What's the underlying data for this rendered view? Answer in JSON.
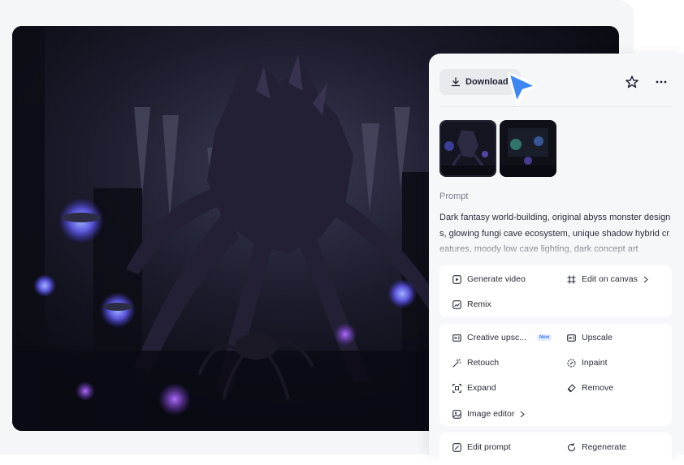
{
  "panel": {
    "download_label": "Download",
    "prompt_label": "Prompt",
    "prompt_text": "Dark fantasy world-building, original abyss monster designs, glowing fungi cave ecosystem, unique shadow hybrid creatures, moody low cave lighting, dark concept art"
  },
  "actions_primary": {
    "generate_video": "Generate video",
    "edit_on_canvas": "Edit on canvas",
    "remix": "Remix"
  },
  "actions_edit": {
    "creative_upscale": "Creative upsc...",
    "creative_upscale_badge": "New",
    "upscale": "Upscale",
    "retouch": "Retouch",
    "inpaint": "Inpaint",
    "expand": "Expand",
    "remove": "Remove",
    "image_editor": "Image editor"
  },
  "actions_bottom": {
    "edit_prompt": "Edit prompt",
    "regenerate": "Regenerate"
  },
  "icons": {
    "download": "download-icon",
    "star": "star-icon",
    "more": "more-horizontal-icon",
    "cursor": "pointer-cursor-icon"
  },
  "colors": {
    "accent_cursor": "#3d86f5",
    "badge": "#3f7cf2",
    "panel_bg": "#f6f7f9"
  }
}
